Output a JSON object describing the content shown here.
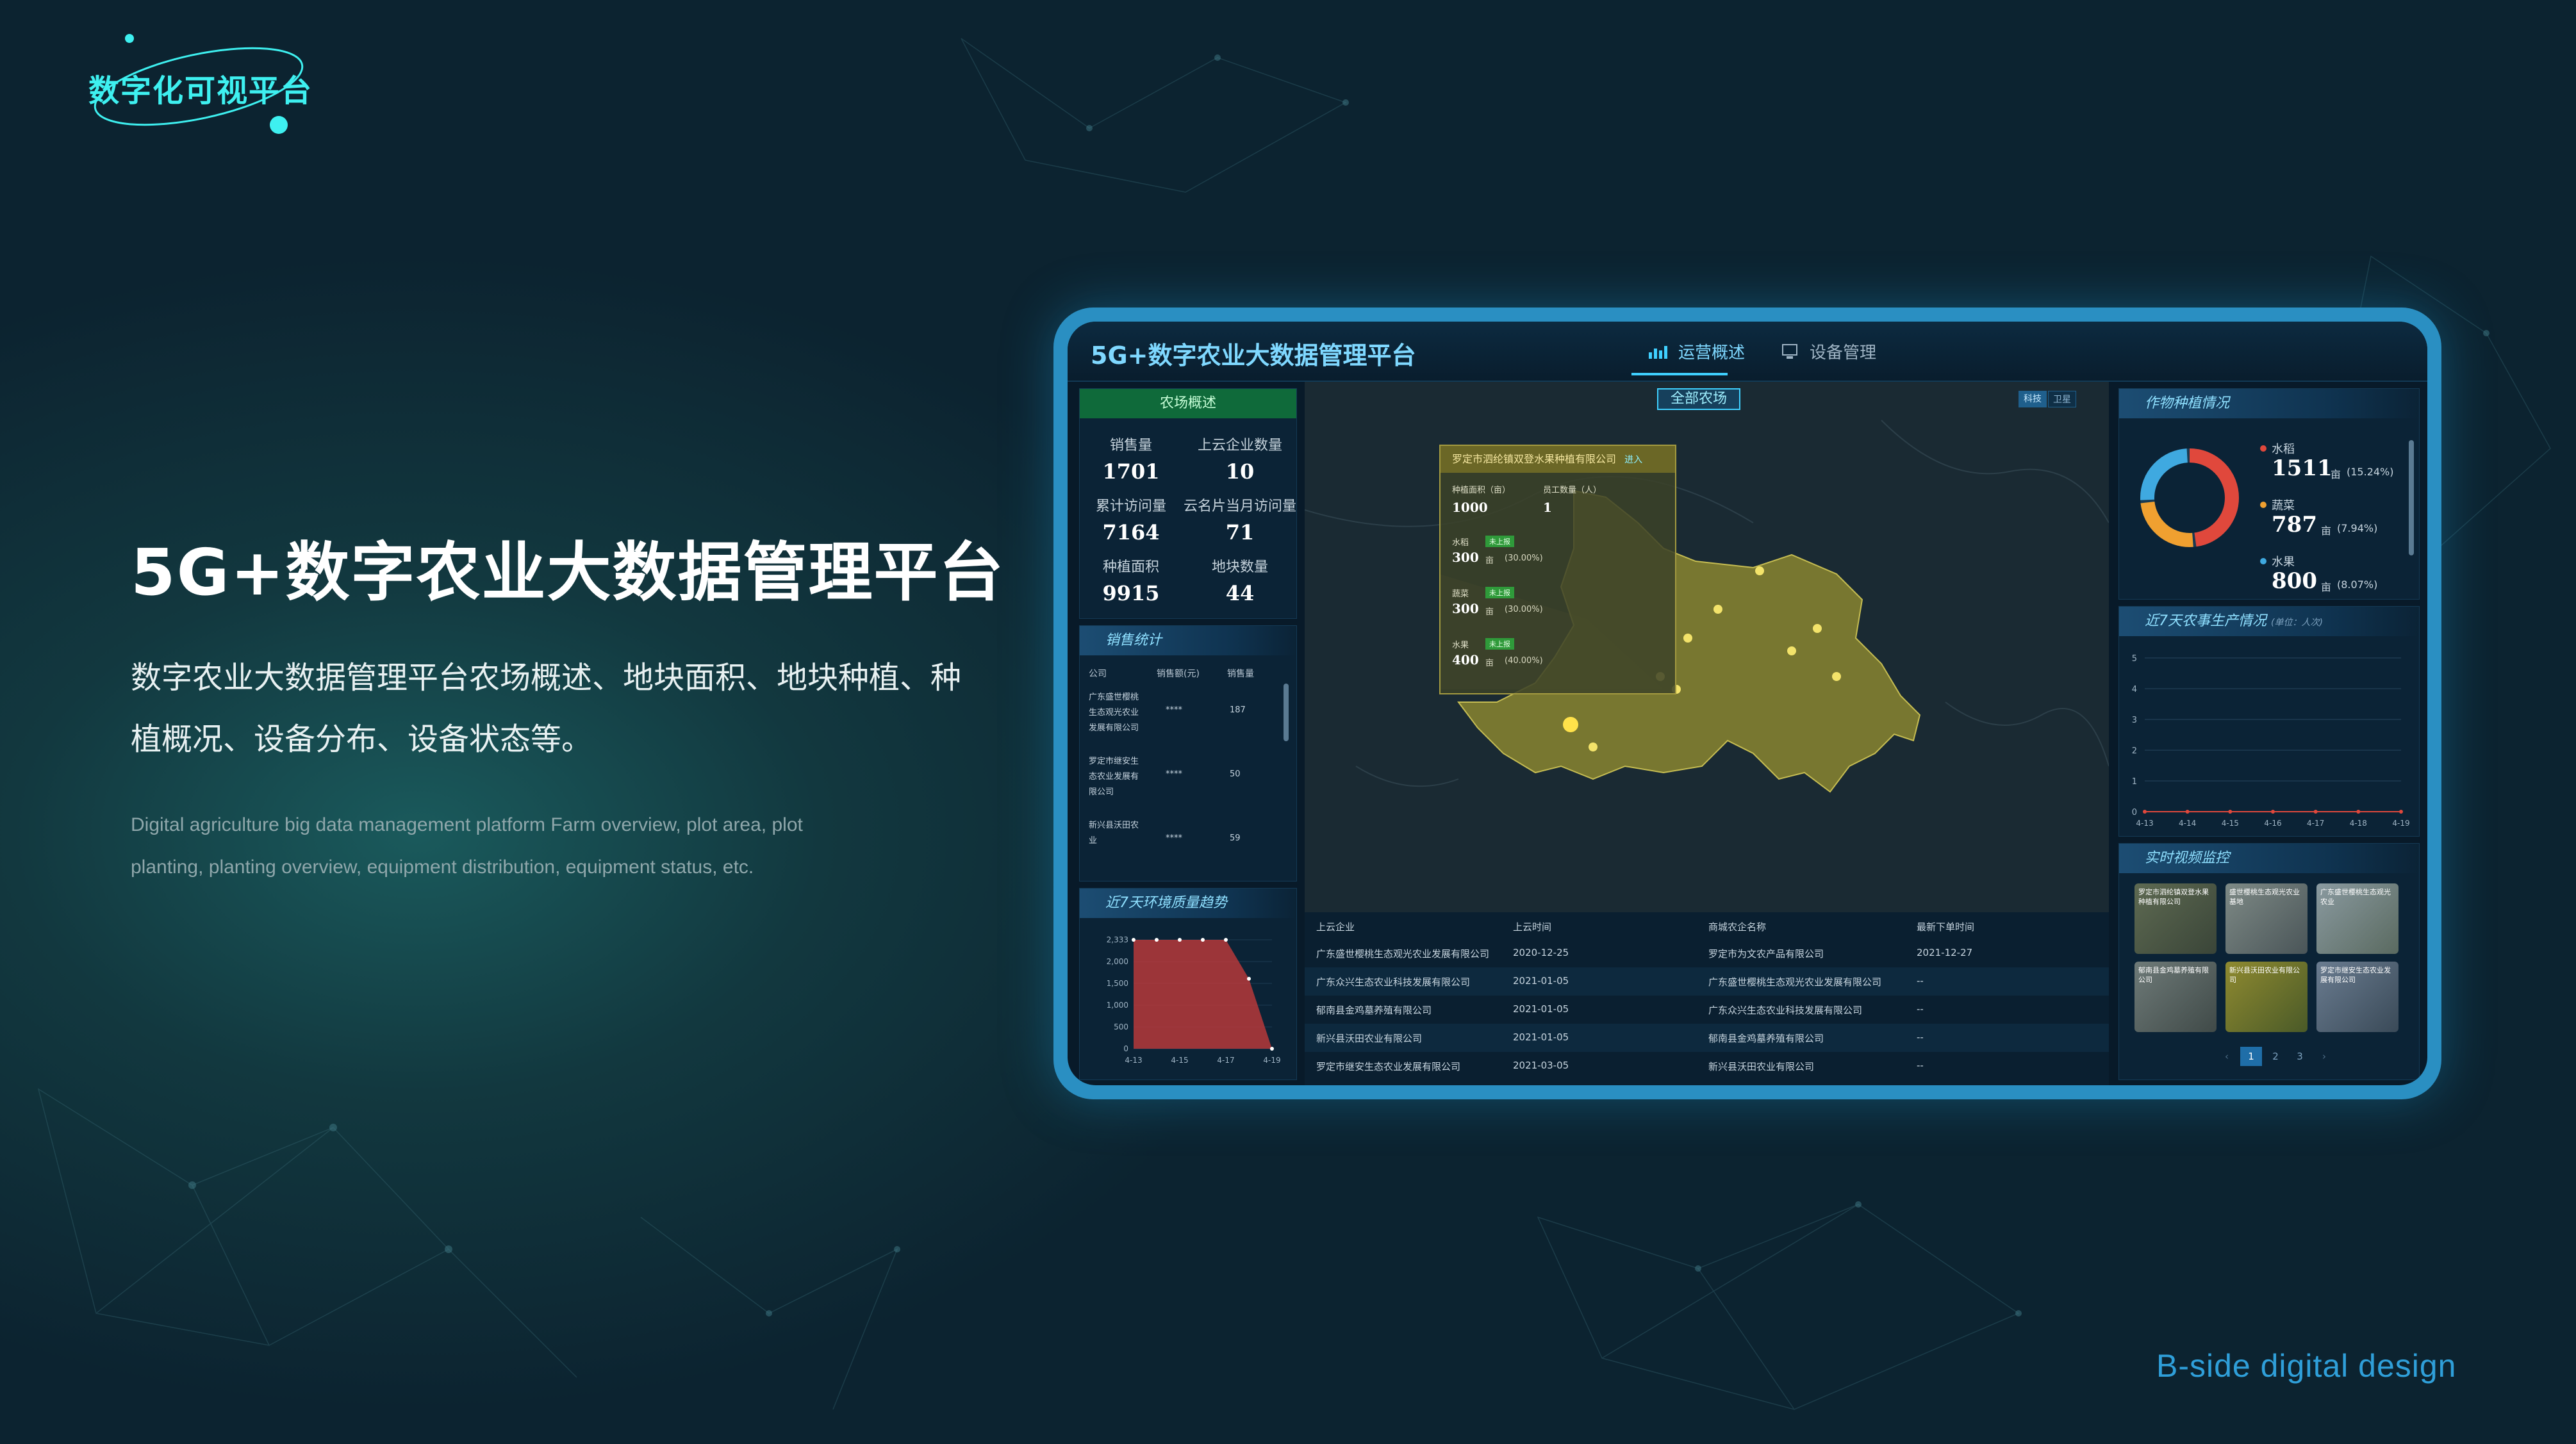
{
  "logo": {
    "text": "数字化可视平台"
  },
  "hero": {
    "title": "5G+数字农业大数据管理平台",
    "description": "数字农业大数据管理平台农场概述、地块面积、地块种植、种植概况、设备分布、设备状态等。",
    "english": "Digital agriculture big data management platform Farm overview, plot area, plot planting, planting overview, equipment distribution, equipment status, etc."
  },
  "brand_tag": "B-side digital design",
  "dashboard": {
    "title": "5G+数字农业大数据管理平台",
    "tabs": [
      {
        "label": "运营概述",
        "icon": "bar-chart-icon",
        "active": true
      },
      {
        "label": "设备管理",
        "icon": "device-icon",
        "active": false
      }
    ],
    "farm": {
      "title": "农场概述",
      "stats": [
        {
          "label": "销售量",
          "value": "1701"
        },
        {
          "label": "上云企业数量",
          "value": "10"
        },
        {
          "label": "累计访问量",
          "value": "7164"
        },
        {
          "label": "云名片当月访问量",
          "value": "71"
        },
        {
          "label": "种植面积",
          "value": "9915"
        },
        {
          "label": "地块数量",
          "value": "44"
        }
      ]
    },
    "sales": {
      "title": "销售统计",
      "headers": [
        "公司",
        "销售额(元)",
        "销售量"
      ],
      "rows": [
        {
          "company": "广东盛世樱桃生态观光农业发展有限公司",
          "amount": "****",
          "qty": "187"
        },
        {
          "company": "罗定市继安生态农业发展有限公司",
          "amount": "****",
          "qty": "50"
        },
        {
          "company": "新兴县沃田农业",
          "amount": "****",
          "qty": "59"
        }
      ]
    },
    "env_trend": {
      "title": "近7天环境质量趋势",
      "chart_data": {
        "type": "area",
        "x": [
          "4-13",
          "4-14",
          "4-15",
          "4-16",
          "4-17",
          "4-18",
          "4-19"
        ],
        "y_ticks": [
          "2,333",
          "2,000",
          "1,500",
          "1,000",
          "500",
          "0"
        ],
        "x_ticks": [
          "4-13",
          "4-15",
          "4-17",
          "4-19"
        ],
        "values": [
          2333,
          2333,
          2333,
          2333,
          2333,
          1500,
          0
        ],
        "ylim": [
          0,
          2333
        ],
        "color": "#c0393b"
      }
    },
    "map": {
      "button": "全部农场",
      "toggles": [
        "科技",
        "卫星"
      ],
      "popup": {
        "company": "罗定市泗纶镇双登水果种植有限公司",
        "enter": "进入",
        "area_label": "种植面积（亩）",
        "staff_label": "员工数量（人）",
        "area": "1000",
        "staff": "1",
        "crops": [
          {
            "name": "水稻",
            "badge": "未上报",
            "value": "300",
            "unit": "亩",
            "pct": "(30.00%)"
          },
          {
            "name": "蔬菜",
            "badge": "未上报",
            "value": "300",
            "unit": "亩",
            "pct": "(30.00%)"
          },
          {
            "name": "水果",
            "badge": "未上报",
            "value": "400",
            "unit": "亩",
            "pct": "(40.00%)"
          }
        ]
      }
    },
    "cloud_table": {
      "headers": [
        "上云企业",
        "上云时间",
        "商城农企名称",
        "最新下单时间"
      ],
      "rows": [
        [
          "广东盛世樱桃生态观光农业发展有限公司",
          "2020-12-25",
          "罗定市为文农产品有限公司",
          "2021-12-27"
        ],
        [
          "广东众兴生态农业科技发展有限公司",
          "2021-01-05",
          "广东盛世樱桃生态观光农业发展有限公司",
          "--"
        ],
        [
          "郁南县金鸡墓养殖有限公司",
          "2021-01-05",
          "广东众兴生态农业科技发展有限公司",
          "--"
        ],
        [
          "新兴县沃田农业有限公司",
          "2021-01-05",
          "郁南县金鸡墓养殖有限公司",
          "--"
        ],
        [
          "罗定市继安生态农业发展有限公司",
          "2021-03-05",
          "新兴县沃田农业有限公司",
          "--"
        ]
      ]
    },
    "crop_planting": {
      "title": "作物种植情况",
      "chart_data": {
        "type": "pie",
        "slices": [
          {
            "name": "水稻",
            "value": 1511,
            "unit": "亩",
            "pct": "(15.24%)",
            "color": "#e0483c"
          },
          {
            "name": "蔬菜",
            "value": 787,
            "unit": "亩",
            "pct": "(7.94%)",
            "color": "#f0a030"
          },
          {
            "name": "水果",
            "value": 800,
            "unit": "亩",
            "pct": "(8.07%)",
            "color": "#3fa9e0"
          }
        ]
      }
    },
    "production": {
      "title": "近7天农事生产情况",
      "unit_label": "(单位：人次)",
      "chart_data": {
        "type": "line",
        "x": [
          "4-13",
          "4-14",
          "4-15",
          "4-16",
          "4-17",
          "4-18",
          "4-19"
        ],
        "values": [
          0,
          0,
          0,
          0,
          0,
          0,
          0
        ],
        "ylim": [
          0,
          5
        ],
        "y_ticks": [
          "5",
          "4",
          "3",
          "2",
          "1",
          "0"
        ]
      }
    },
    "video": {
      "title": "实时视频监控",
      "thumbs": [
        {
          "caption": "罗定市泗纶镇双登水果种植有限公司"
        },
        {
          "caption": "盛世樱桃生态观光农业基地"
        },
        {
          "caption": "广东盛世樱桃生态观光农业"
        },
        {
          "caption": "郁南县金鸡墓养殖有限公司"
        },
        {
          "caption": "新兴县沃田农业有限公司"
        },
        {
          "caption": "罗定市继安生态农业发展有限公司"
        }
      ],
      "pages": [
        "1",
        "2",
        "3"
      ]
    }
  }
}
